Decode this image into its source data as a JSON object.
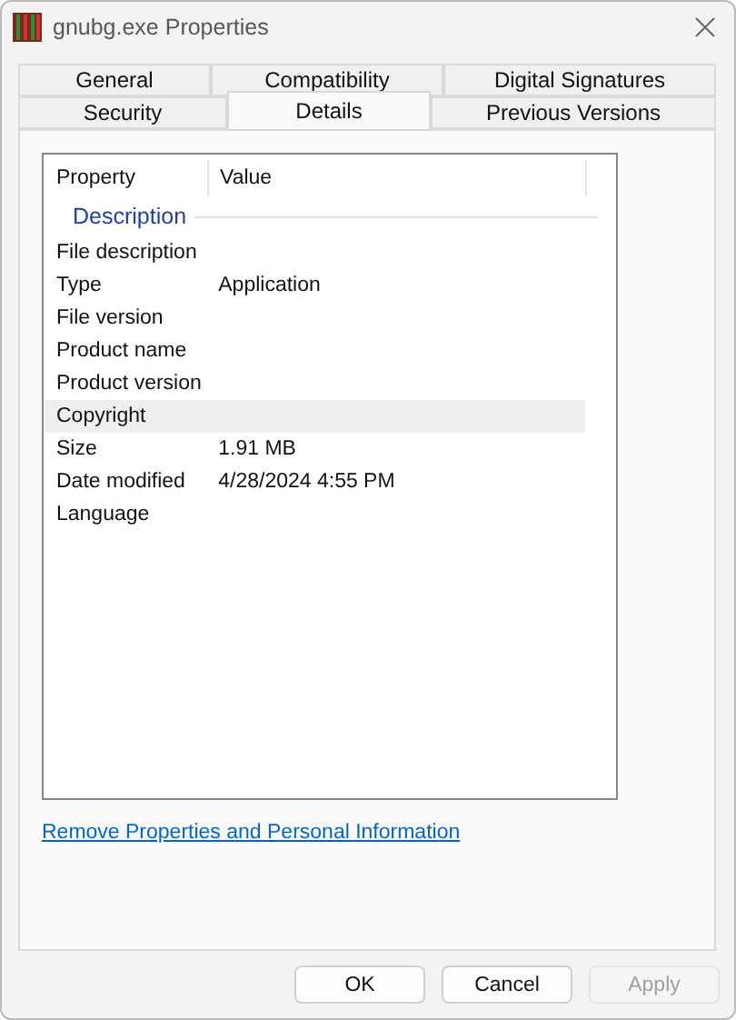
{
  "window": {
    "title": "gnubg.exe Properties"
  },
  "tab_rows": [
    [
      {
        "label": "General",
        "selected": false
      },
      {
        "label": "Compatibility",
        "selected": false
      },
      {
        "label": "Digital Signatures",
        "selected": false
      }
    ],
    [
      {
        "label": "Security",
        "selected": false
      },
      {
        "label": "Details",
        "selected": true
      },
      {
        "label": "Previous Versions",
        "selected": false
      }
    ]
  ],
  "table": {
    "columns": [
      "Property",
      "Value"
    ],
    "group": "Description",
    "rows": [
      {
        "property": "File description",
        "selected": false
      },
      {
        "property": "Type",
        "value": "Application",
        "selected": false
      },
      {
        "property": "File version",
        "selected": false
      },
      {
        "property": "Product name",
        "selected": false
      },
      {
        "property": "Product version",
        "selected": false
      },
      {
        "property": "Copyright",
        "selected": true
      },
      {
        "property": "Size",
        "value": "1.91 MB",
        "selected": false
      },
      {
        "property": "Date modified",
        "value": "4/28/2024 4:55 PM",
        "selected": false
      },
      {
        "property": "Language",
        "selected": false
      }
    ]
  },
  "link": "Remove Properties and Personal Information",
  "buttons": [
    {
      "label": "OK",
      "disabled": false
    },
    {
      "label": "Cancel",
      "disabled": false
    },
    {
      "label": "Apply",
      "disabled": true
    }
  ]
}
